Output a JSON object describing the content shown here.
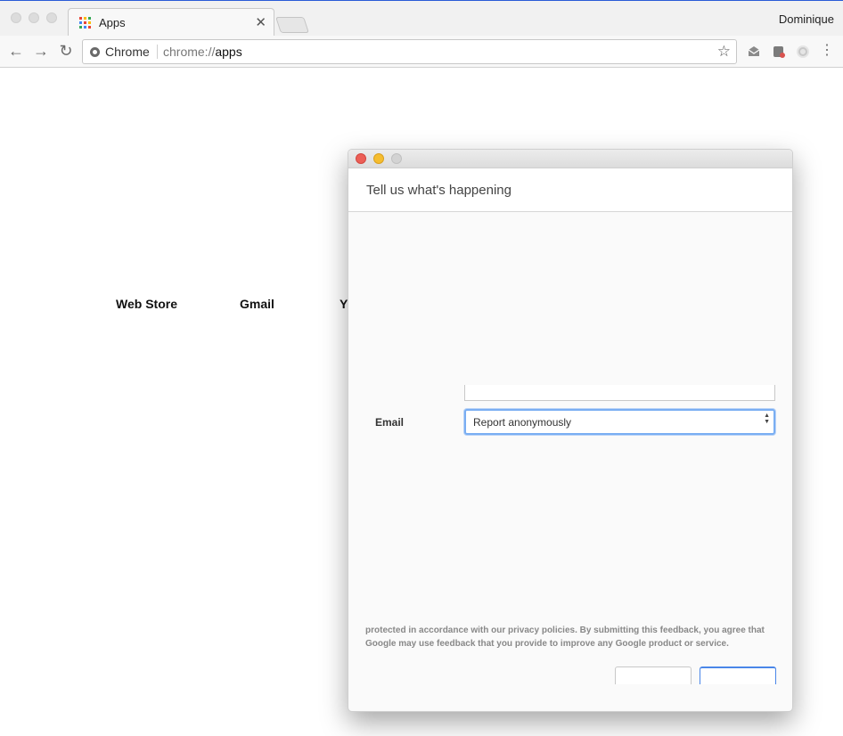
{
  "browser": {
    "tab": {
      "title": "Apps",
      "close_glyph": "✕",
      "icon": "apps-grid-icon"
    },
    "profile_name": "Dominique",
    "nav": {
      "back_glyph": "←",
      "forward_glyph": "→",
      "reload_glyph": "↻"
    },
    "omnibox": {
      "scheme_label": "Chrome",
      "url_prefix": "chrome://",
      "url_path": "apps",
      "star_glyph": "☆"
    },
    "menu_glyph": "⋮"
  },
  "apps": [
    "Web Store",
    "Gmail",
    "Y"
  ],
  "feedback_dialog": {
    "title": "Tell us what's happening",
    "email_label": "Email",
    "email_select": {
      "selected": "Report anonymously"
    },
    "legal_text": "protected in accordance with our privacy policies. By submitting this feedback, you agree that Google may use feedback that you provide to improve any Google product or service."
  },
  "colors": {
    "close": "#ec5f57",
    "minimize": "#f5bd2f",
    "focus_ring": "#7aaef2",
    "send_button": "#4a86e8"
  }
}
